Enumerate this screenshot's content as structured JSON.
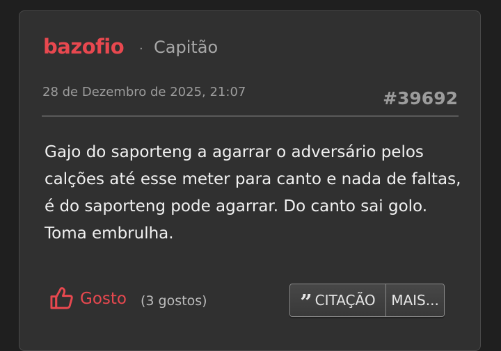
{
  "post": {
    "author": "bazofio",
    "separator": "·",
    "rank": "Capitão",
    "date": "28 de Dezembro de 2025, 21:07",
    "number": "#39692",
    "body": "Gajo do saporteng a agarrar o adversário pelos calções até esse meter para canto e nada de faltas, é do saporteng pode agarrar. Do canto sai golo. Toma embrulha."
  },
  "actions": {
    "like_label": "Gosto",
    "like_count": "(3 gostos)",
    "quote_glyph": "”",
    "quote_label": "CITAÇÃO",
    "more_label": "MAIS..."
  },
  "colors": {
    "accent": "#e8484f",
    "card_bg": "#303030",
    "page_bg": "#1f1f1f"
  },
  "icons": {
    "like": "thumbs-up-icon",
    "quote": "quote-icon"
  }
}
